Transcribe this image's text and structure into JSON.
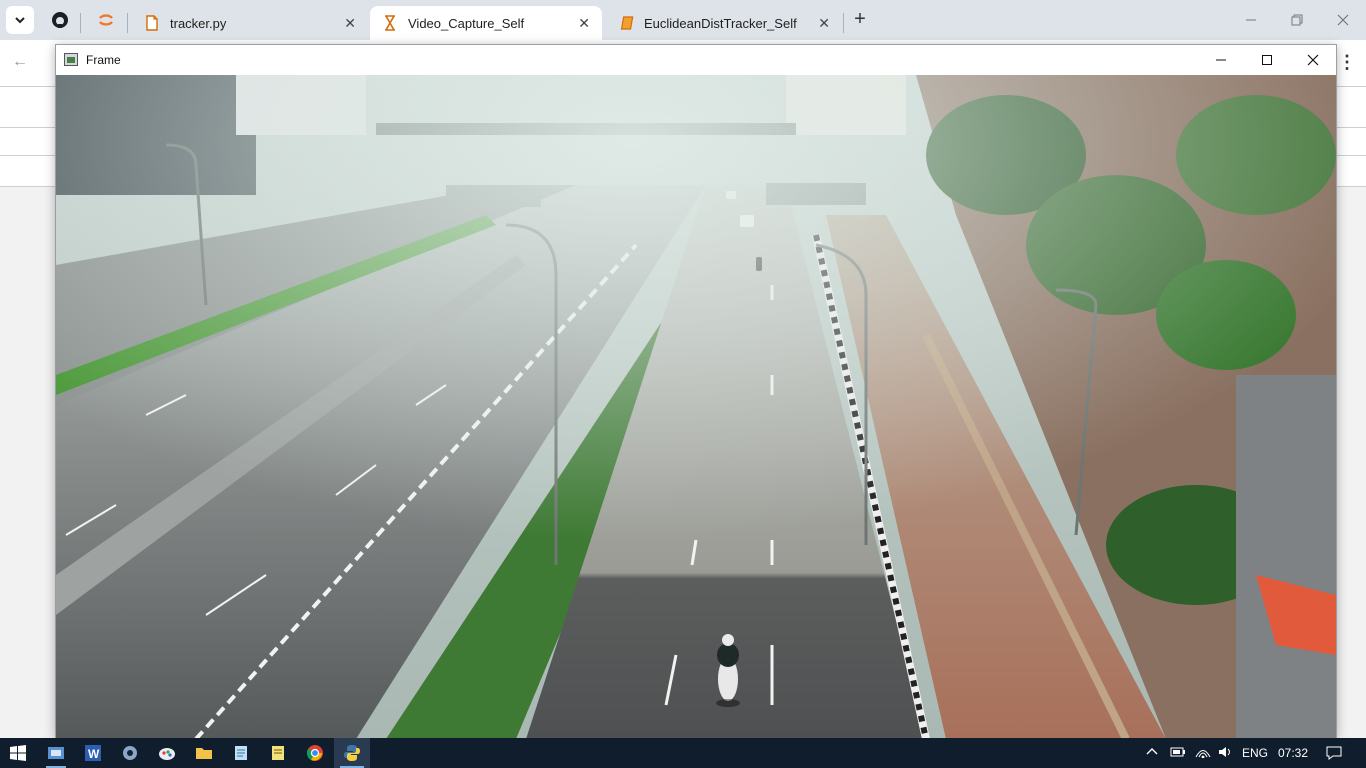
{
  "browser": {
    "tabs": [
      {
        "label": "tracker.py",
        "icon": "document-icon",
        "active": false
      },
      {
        "label": "Video_Capture_Self",
        "icon": "hourglass-icon",
        "active": true
      },
      {
        "label": "EuclideanDistTracker_Self",
        "icon": "notebook-icon",
        "active": false
      }
    ],
    "pinned": [
      "github-icon",
      "jupyter-icon"
    ],
    "close_glyph": "✕",
    "new_tab_glyph": "+",
    "kebab_glyph": "⋮",
    "back_glyph": "←"
  },
  "frame_window": {
    "title": "Frame",
    "controls": [
      "minimize-icon",
      "maximize-icon",
      "close-icon"
    ]
  },
  "taskbar": {
    "apps": [
      "start-icon",
      "control-panel-icon",
      "word-icon",
      "settings-app-icon",
      "paint-icon",
      "file-explorer-icon",
      "notepad-icon",
      "notes-icon",
      "chrome-icon",
      "python-icon"
    ],
    "tray": {
      "language": "ENG",
      "time": "07:32"
    }
  },
  "colors": {
    "accent": "#d46b08",
    "taskbar": "#101d2d",
    "tab_active": "#ffffff",
    "tabstrip": "#dee3e9"
  }
}
